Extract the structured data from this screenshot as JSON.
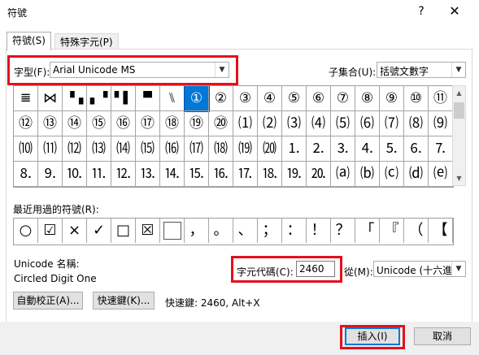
{
  "window": {
    "title": "符號",
    "help": "?",
    "close": "✕"
  },
  "tabs": [
    {
      "label": "符號(S)"
    },
    {
      "label": "特殊字元(P)"
    }
  ],
  "font_label": "字型(F):",
  "font_value": "Arial Unicode MS",
  "subset_label": "子集合(U):",
  "subset_value": "括號文數字",
  "grid_rows": [
    [
      "𝌆",
      "⋈",
      "▝▗",
      "▖▝",
      "▘▌",
      "▝▘",
      "⑊",
      "①",
      "②",
      "③",
      "④",
      "⑤",
      "⑥",
      "⑦",
      "⑧",
      "⑨",
      "⑩",
      "⑪"
    ],
    [
      "⑫",
      "⑬",
      "⑭",
      "⑮",
      "⑯",
      "⑰",
      "⑱",
      "⑲",
      "⑳",
      "⑴",
      "⑵",
      "⑶",
      "⑷",
      "⑸",
      "⑹",
      "⑺",
      "⑻",
      "⑼"
    ],
    [
      "⑽",
      "⑾",
      "⑿",
      "⒀",
      "⒁",
      "⒂",
      "⒃",
      "⒄",
      "⒅",
      "⒆",
      "⒇",
      "⒈",
      "⒉",
      "⒊",
      "⒋",
      "⒌",
      "⒍",
      "⒎"
    ],
    [
      "⒏",
      "⒐",
      "⒑",
      "⒒",
      "⒓",
      "⒔",
      "⒕",
      "⒖",
      "⒗",
      "⒘",
      "⒙",
      "⒚",
      "⒛",
      "⒜",
      "⒝",
      "⒞",
      "⒟",
      "⒠"
    ]
  ],
  "recent_label": "最近用過的符號(R):",
  "recent": [
    "○",
    "☑",
    "×",
    "✓",
    "□",
    "☒",
    "",
    "，",
    "。",
    "、",
    "；",
    "：",
    "！",
    "？",
    "「",
    "『",
    "（",
    "【"
  ],
  "unicode_name_label": "Unicode 名稱:",
  "unicode_name_value": "Circled Digit One",
  "charcode_label": "字元代碼(C):",
  "charcode_value": "2460",
  "from_label": "從(M):",
  "from_value": "Unicode (十六進",
  "autocorrect_button": "自動校正(A)...",
  "shortcut_button": "快速鍵(K)...",
  "shortcut_text": "快速鍵: 2460, Alt+X",
  "insert_button": "插入(I)",
  "cancel_button": "取消",
  "colors": {
    "selection": "#0078d7",
    "highlight": "#e4101c"
  }
}
